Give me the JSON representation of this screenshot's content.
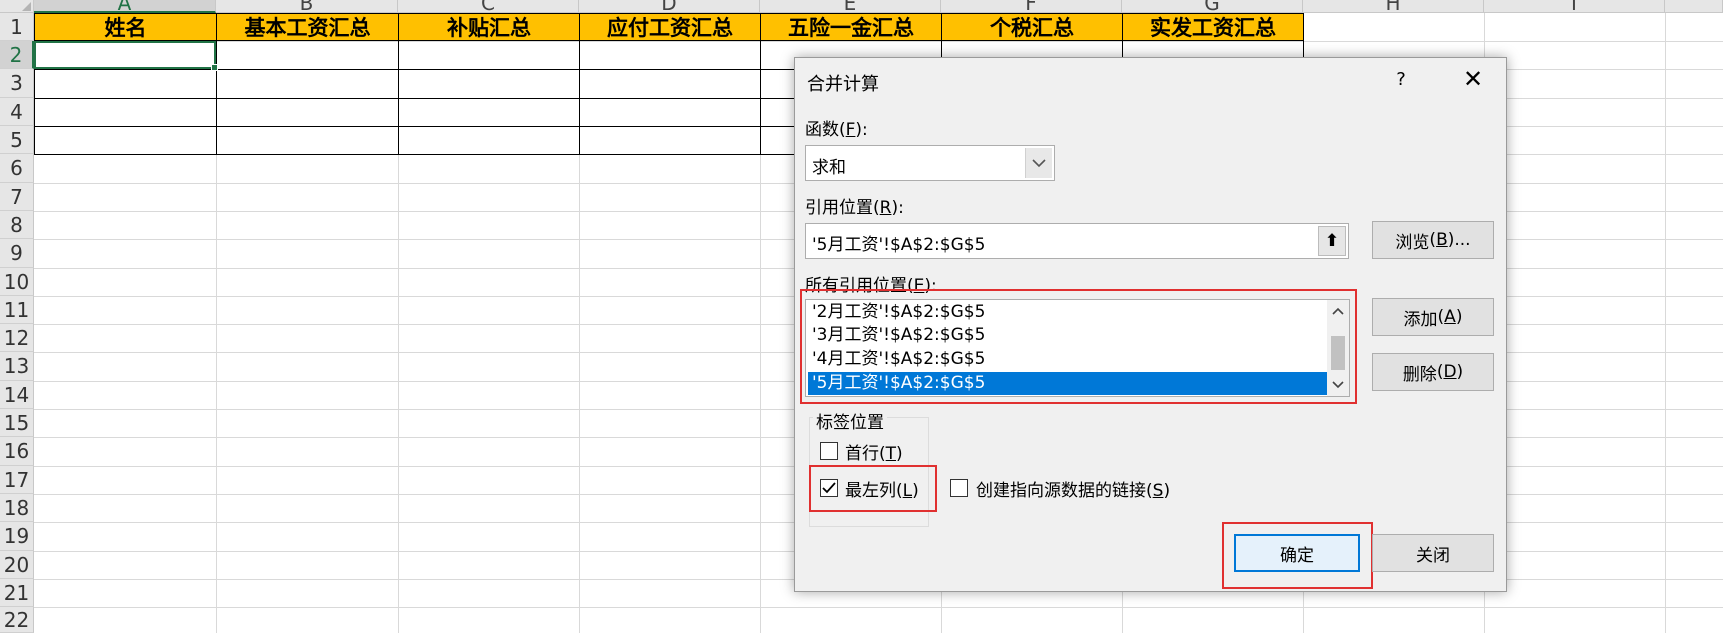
{
  "sheet": {
    "columns": [
      "A",
      "B",
      "C",
      "D",
      "E",
      "F",
      "G",
      "H",
      "I"
    ],
    "rows": [
      "1",
      "2",
      "3",
      "4",
      "5",
      "6",
      "7",
      "8",
      "9",
      "10",
      "11",
      "12",
      "13",
      "14",
      "15",
      "16",
      "17",
      "18",
      "19",
      "20",
      "21",
      "22"
    ],
    "headers": [
      "姓名",
      "基本工资汇总",
      "补贴汇总",
      "应付工资汇总",
      "五险一金汇总",
      "个税汇总",
      "实发工资汇总"
    ],
    "header_fill": "#ffc000",
    "accent": "#217346"
  },
  "dialog": {
    "title": "合并计算",
    "help_glyph": "?",
    "close_glyph": "✕",
    "function_label": "函数",
    "function_key": "F",
    "function_value": "求和",
    "reference_label": "引用位置",
    "reference_key": "R",
    "reference_value": "'5月工资'!$A$2:$G$5",
    "collapse_glyph": "⬆",
    "browse_label": "浏览",
    "browse_key": "B",
    "all_refs_label": "所有引用位置",
    "all_refs_key": "E",
    "all_refs": [
      "'2月工资'!$A$2:$G$5",
      "'3月工资'!$A$2:$G$5",
      "'4月工资'!$A$2:$G$5",
      "'5月工资'!$A$2:$G$5"
    ],
    "selected_ref_index": 3,
    "add_label": "添加",
    "add_key": "A",
    "delete_label": "删除",
    "delete_key": "D",
    "label_group_title": "标签位置",
    "top_row_label": "首行",
    "top_row_key": "T",
    "top_row_checked": false,
    "left_col_label": "最左列",
    "left_col_key": "L",
    "left_col_checked": true,
    "link_label": "创建指向源数据的链接",
    "link_key": "S",
    "link_checked": false,
    "ok_label": "确定",
    "close_label": "关闭",
    "highlight_color": "#e03030",
    "selection_color": "#0078d7"
  }
}
